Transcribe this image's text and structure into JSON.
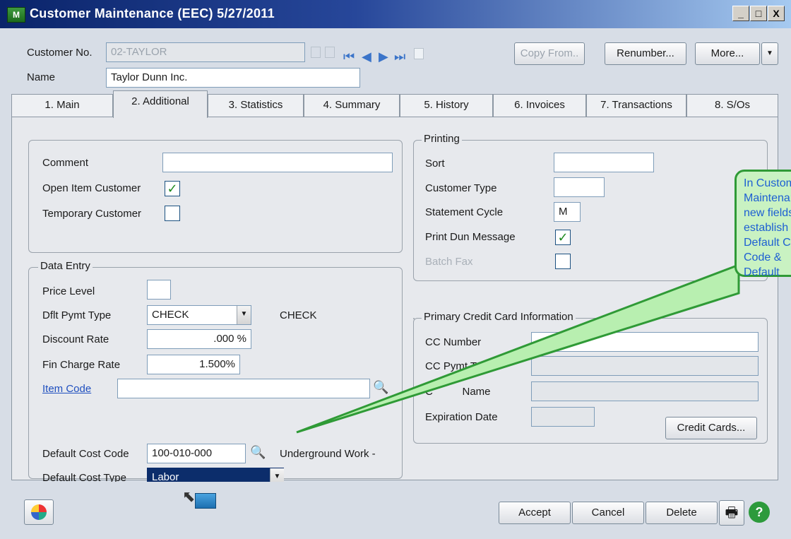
{
  "window": {
    "title": "Customer Maintenance (EEC) 5/27/2011",
    "app_icon_text": "M",
    "controls": {
      "minimize": "_",
      "maximize": "□",
      "close": "X"
    }
  },
  "header": {
    "customer_no_label": "Customer No.",
    "customer_no_value": "02-TAYLOR",
    "name_label": "Name",
    "name_value": "Taylor Dunn Inc.",
    "copy_from_label": "Copy From..",
    "renumber_label": "Renumber...",
    "more_label": "More...",
    "more_arrow": "▼"
  },
  "tabs": [
    {
      "label": "1. Main"
    },
    {
      "label": "2. Additional"
    },
    {
      "label": "3. Statistics"
    },
    {
      "label": "4. Summary"
    },
    {
      "label": "5. History"
    },
    {
      "label": "6. Invoices"
    },
    {
      "label": "7. Transactions"
    },
    {
      "label": "8. S/Os"
    }
  ],
  "general": {
    "comment_label": "Comment",
    "comment_value": "",
    "open_item_label": "Open Item Customer",
    "open_item_checked": true,
    "temporary_label": "Temporary Customer",
    "temporary_checked": false
  },
  "data_entry": {
    "title": "Data Entry",
    "price_level_label": "Price Level",
    "price_level_value": "",
    "pymt_type_label": "Dflt Pymt Type",
    "pymt_type_value": "CHECK",
    "pymt_type_desc": "CHECK",
    "discount_label": "Discount Rate",
    "discount_value": ".000 %",
    "fin_charge_label": "Fin Charge Rate",
    "fin_charge_value": "1.500%",
    "item_code_label": "Item Code",
    "item_code_value": "",
    "cost_code_label": "Default Cost Code",
    "cost_code_value": "100-010-000",
    "cost_code_desc": "Underground Work -",
    "cost_type_label": "Default Cost Type",
    "cost_type_value": "Labor"
  },
  "printing": {
    "title": "Printing",
    "sort_label": "Sort",
    "sort_value": "",
    "customer_type_label": "Customer Type",
    "customer_type_value": "",
    "statement_cycle_label": "Statement Cycle",
    "statement_cycle_value": "M",
    "print_dun_label": "Print Dun Message",
    "print_dun_checked": true,
    "batch_fax_label": "Batch Fax",
    "batch_fax_checked": false
  },
  "credit_card": {
    "title": "Primary Credit Card Information",
    "cc_number_label": "CC Number",
    "cc_pymt_type_label": "CC Pymt Type",
    "cardholder_label_visible": "C          Name",
    "expiration_label": "Expiration Date",
    "credit_cards_button": "Credit Cards..."
  },
  "footer": {
    "accept_label": "Accept",
    "cancel_label": "Cancel",
    "delete_label": "Delete"
  },
  "callout": {
    "text": "In Customer Maintenance new fields establish Default Cost Code & Default"
  }
}
